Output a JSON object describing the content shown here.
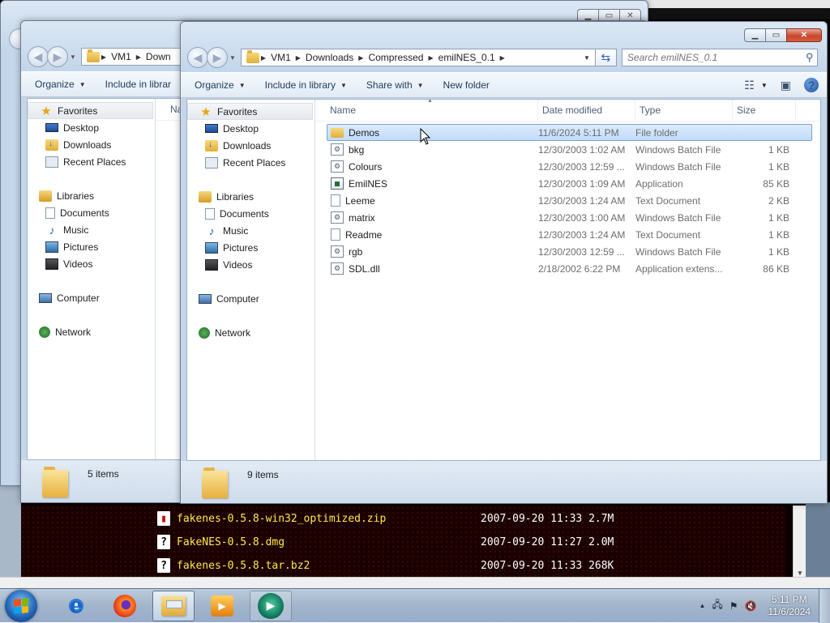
{
  "background": {
    "listing": [
      {
        "icon": "zip-file-icon",
        "name": "fakenes-0.5.8-win32_optimized.zip",
        "date": "2007-09-20 11:33",
        "size": "2.7M"
      },
      {
        "icon": "unknown-file-icon",
        "name": "FakeNES-0.5.8.dmg",
        "date": "2007-09-20 11:27",
        "size": "2.0M"
      },
      {
        "icon": "unknown-file-icon",
        "name": "fakenes-0.5.8.tar.bz2",
        "date": "2007-09-20 11:33",
        "size": "268K"
      }
    ]
  },
  "back_window": {
    "address": [
      "VM1",
      "Down"
    ],
    "toolbar": {
      "organize": "Organize",
      "include": "Include in librar"
    },
    "column_name_partial": "Na",
    "status": "5 items"
  },
  "front_window": {
    "address": [
      "VM1",
      "Downloads",
      "Compressed",
      "emilNES_0.1"
    ],
    "search_placeholder": "Search emilNES_0.1",
    "toolbar": {
      "organize": "Organize",
      "include": "Include in library",
      "share": "Share with",
      "new_folder": "New folder"
    },
    "columns": {
      "name": "Name",
      "date": "Date modified",
      "type": "Type",
      "size": "Size"
    },
    "files": [
      {
        "name": "Demos",
        "date": "11/6/2024 5:11 PM",
        "type": "File folder",
        "size": "",
        "icon": "folder-icon",
        "selected": true
      },
      {
        "name": "bkg",
        "date": "12/30/2003 1:02 AM",
        "type": "Windows Batch File",
        "size": "1 KB",
        "icon": "batch-file-icon"
      },
      {
        "name": "Colours",
        "date": "12/30/2003 12:59 ...",
        "type": "Windows Batch File",
        "size": "1 KB",
        "icon": "batch-file-icon"
      },
      {
        "name": "EmilNES",
        "date": "12/30/2003 1:09 AM",
        "type": "Application",
        "size": "85 KB",
        "icon": "application-icon"
      },
      {
        "name": "Leeme",
        "date": "12/30/2003 1:24 AM",
        "type": "Text Document",
        "size": "2 KB",
        "icon": "text-document-icon"
      },
      {
        "name": "matrix",
        "date": "12/30/2003 1:00 AM",
        "type": "Windows Batch File",
        "size": "1 KB",
        "icon": "batch-file-icon"
      },
      {
        "name": "Readme",
        "date": "12/30/2003 1:24 AM",
        "type": "Text Document",
        "size": "1 KB",
        "icon": "text-document-icon"
      },
      {
        "name": "rgb",
        "date": "12/30/2003 12:59 ...",
        "type": "Windows Batch File",
        "size": "1 KB",
        "icon": "batch-file-icon"
      },
      {
        "name": "SDL.dll",
        "date": "2/18/2002 6:22 PM",
        "type": "Application extens...",
        "size": "86 KB",
        "icon": "dll-file-icon"
      }
    ],
    "status": "9 items"
  },
  "nav": {
    "favorites": "Favorites",
    "desktop": "Desktop",
    "downloads": "Downloads",
    "recent": "Recent Places",
    "libraries": "Libraries",
    "documents": "Documents",
    "music": "Music",
    "pictures": "Pictures",
    "videos": "Videos",
    "computer": "Computer",
    "network": "Network"
  },
  "taskbar": {
    "time": "5:11 PM",
    "date": "11/6/2024",
    "apps": [
      "internet-explorer-icon",
      "firefox-icon",
      "windows-explorer-icon",
      "media-player-icon",
      "emulator-icon"
    ]
  }
}
